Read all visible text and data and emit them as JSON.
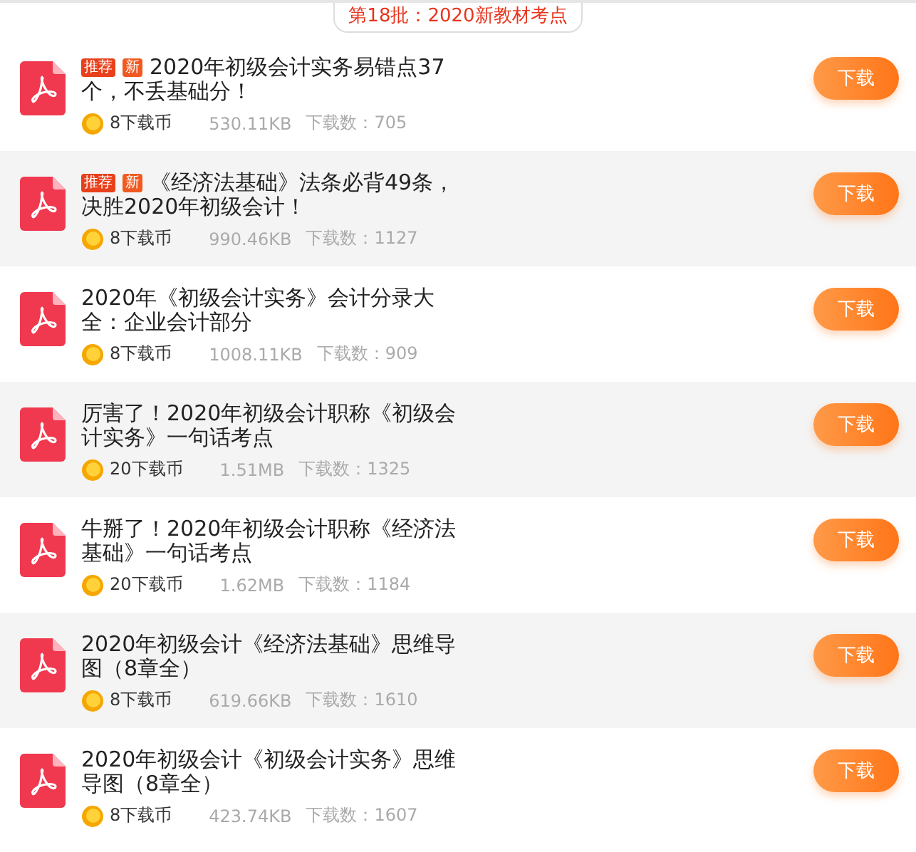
{
  "header": {
    "title": "第18批：2020新教材考点"
  },
  "files": [
    {
      "tags": [
        {
          "kind": "recommend",
          "label": "推荐"
        },
        {
          "kind": "new",
          "label": "新"
        }
      ],
      "title": "2020年初级会计实务易错点37个，不丢基础分！",
      "coins": "8下载币",
      "size": "530.11KB",
      "downloads": "下载数：705",
      "button": "下载"
    },
    {
      "tags": [
        {
          "kind": "recommend",
          "label": "推荐"
        },
        {
          "kind": "new",
          "label": "新"
        }
      ],
      "title": "《经济法基础》法条必背49条，决胜2020年初级会计！",
      "coins": "8下载币",
      "size": "990.46KB",
      "downloads": "下载数：1127",
      "button": "下载"
    },
    {
      "title": "2020年《初级会计实务》会计分录大全：企业会计部分",
      "coins": "8下载币",
      "size": "1008.11KB",
      "downloads": "下载数：909",
      "button": "下载"
    },
    {
      "title": "厉害了！2020年初级会计职称《初级会计实务》一句话考点",
      "coins": "20下载币",
      "size": "1.51MB",
      "downloads": "下载数：1325",
      "button": "下载"
    },
    {
      "title": "牛掰了！2020年初级会计职称《经济法基础》一句话考点",
      "coins": "20下载币",
      "size": "1.62MB",
      "downloads": "下载数：1184",
      "button": "下载"
    },
    {
      "title": "2020年初级会计《经济法基础》思维导图（8章全）",
      "coins": "8下载币",
      "size": "619.66KB",
      "downloads": "下载数：1610",
      "button": "下载"
    },
    {
      "title": "2020年初级会计《初级会计实务》思维导图（8章全）",
      "coins": "8下载币",
      "size": "423.74KB",
      "downloads": "下载数：1607",
      "button": "下载"
    }
  ]
}
